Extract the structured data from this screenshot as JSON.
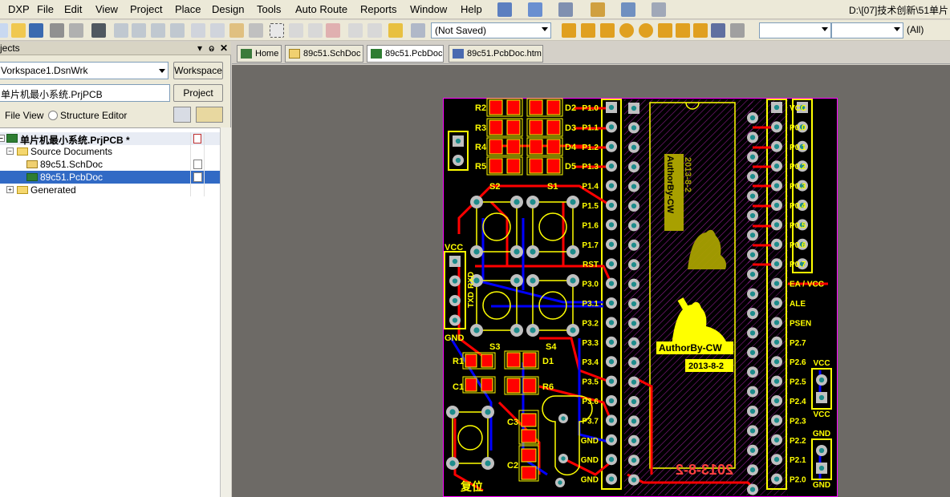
{
  "menubar": {
    "items": [
      {
        "label": "DXP",
        "x_hint": "dxp"
      },
      {
        "label": "File"
      },
      {
        "label": "Edit"
      },
      {
        "label": "View"
      },
      {
        "label": "Project"
      },
      {
        "label": "Place"
      },
      {
        "label": "Design"
      },
      {
        "label": "Tools"
      },
      {
        "label": "Auto Route"
      },
      {
        "label": "Reports"
      },
      {
        "label": "Window"
      },
      {
        "label": "Help"
      }
    ],
    "path_text": "D:\\[07]技术创新\\51单片"
  },
  "toolbar": {
    "save_status": "(Not Saved)",
    "layer_combo": "",
    "filter_combo": "",
    "all_combo": "(All)"
  },
  "left_panel": {
    "title": "jects",
    "workspace_value": "Vorkspace1.DsnWrk",
    "workspace_button": "Workspace",
    "project_value": "单片机最小系统.PrjPCB",
    "project_button": "Project",
    "file_view_label": "File View",
    "structure_editor_label": "Structure Editor",
    "tree": {
      "project": "单片机最小系统.PrjPCB *",
      "source_documents": "Source Documents",
      "sch_doc": "89c51.SchDoc",
      "pcb_doc": "89c51.PcbDoc",
      "generated": "Generated"
    }
  },
  "doc_tabs": [
    {
      "label": "Home"
    },
    {
      "label": "89c51.SchDoc"
    },
    {
      "label": "89c51.PcbDoc"
    },
    {
      "label": "89c51.PcbDoc.htm"
    }
  ],
  "pcb": {
    "labels": {
      "r2": "R2",
      "r3": "R3",
      "r4": "R4",
      "r5": "R5",
      "d2": "D2",
      "d3": "D3",
      "d4": "D4",
      "d5": "D5",
      "s2": "S2",
      "s1": "S1",
      "s3": "S3",
      "s4": "S4",
      "r1": "R1",
      "c1": "C1",
      "d1": "D1",
      "r6": "R6",
      "c3": "C3",
      "c2": "C2",
      "vcc_left": "VCC",
      "gnd_left": "GND",
      "txd": "TXD",
      "rxd": "RXD",
      "reset": "复位",
      "author": "AuthorBy-CW",
      "date": "2013-8-2",
      "author_mirror": "AuthorBy-CW",
      "date_mirror": "2013-8-2",
      "bottom_date": "2013-8-2"
    },
    "left_pins": [
      "P1.0",
      "P1.1",
      "P1.2",
      "P1.3",
      "P1.4",
      "P1.5",
      "P1.6",
      "P1.7",
      "RST",
      "P3.0",
      "P3.1",
      "P3.2",
      "P3.3",
      "P3.4",
      "P3.5",
      "P3.6",
      "P3.7",
      "GND",
      "GND",
      "GND"
    ],
    "right_pins": [
      "VCC",
      "P0.0",
      "P0.1",
      "P0.2",
      "P0.3",
      "P0.4",
      "P0.5",
      "P0.6",
      "P0.7",
      "EA / VCC",
      "ALE",
      "PSEN",
      "P2.7",
      "P2.6",
      "P2.5",
      "P2.4",
      "P2.3",
      "P2.2",
      "P2.1",
      "P2.0"
    ],
    "right_conn": {
      "vcc_top": "VCC",
      "vcc_bottom": "VCC",
      "gnd_top": "GND",
      "gnd_bottom": "GND"
    },
    "colors": {
      "board": "#000000",
      "outline": "#ff00ff",
      "silk": "#ffff00",
      "top_copper": "#ff0000",
      "bottom_copper": "#0000ff",
      "pad": "#c0c0c0",
      "hole": "#1e8c8c",
      "overlay_mirror": "#ff33ff"
    }
  }
}
